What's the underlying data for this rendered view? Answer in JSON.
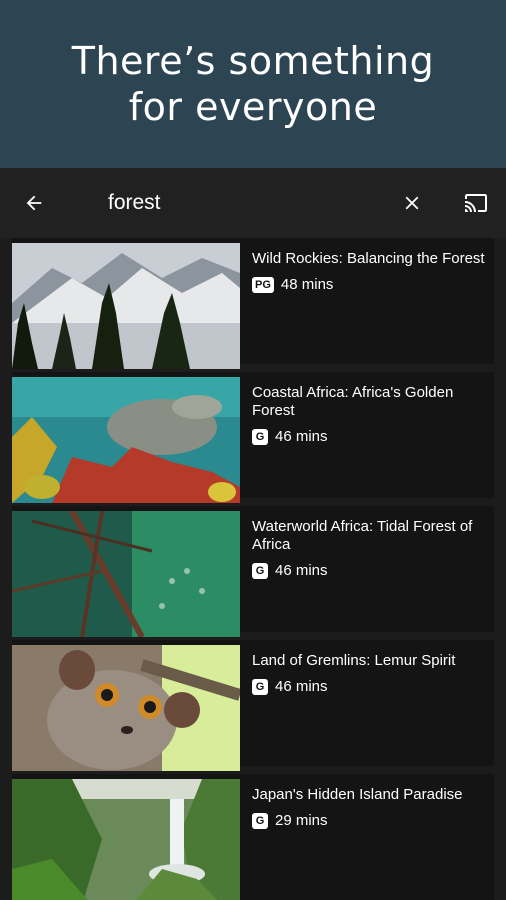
{
  "banner": {
    "line1": "There’s something",
    "line2": "for everyone"
  },
  "toolbar": {
    "back_icon": "arrow-back-icon",
    "search_value": "forest",
    "clear_icon": "close-icon",
    "cast_icon": "cast-icon"
  },
  "results": [
    {
      "title": "Wild Rockies: Balancing the Forest",
      "rating": "PG",
      "duration": "48 mins"
    },
    {
      "title": "Coastal Africa: Africa's Golden Forest",
      "rating": "G",
      "duration": "46 mins"
    },
    {
      "title": "Waterworld Africa: Tidal Forest of Africa",
      "rating": "G",
      "duration": "46 mins"
    },
    {
      "title": "Land of Gremlins: Lemur Spirit",
      "rating": "G",
      "duration": "46 mins"
    },
    {
      "title": "Japan's Hidden Island Paradise",
      "rating": "G",
      "duration": "29 mins"
    }
  ],
  "colors": {
    "banner_bg": "#2d4453",
    "toolbar_bg": "#212121",
    "card_bg": "#141414",
    "text": "#ffffff"
  }
}
